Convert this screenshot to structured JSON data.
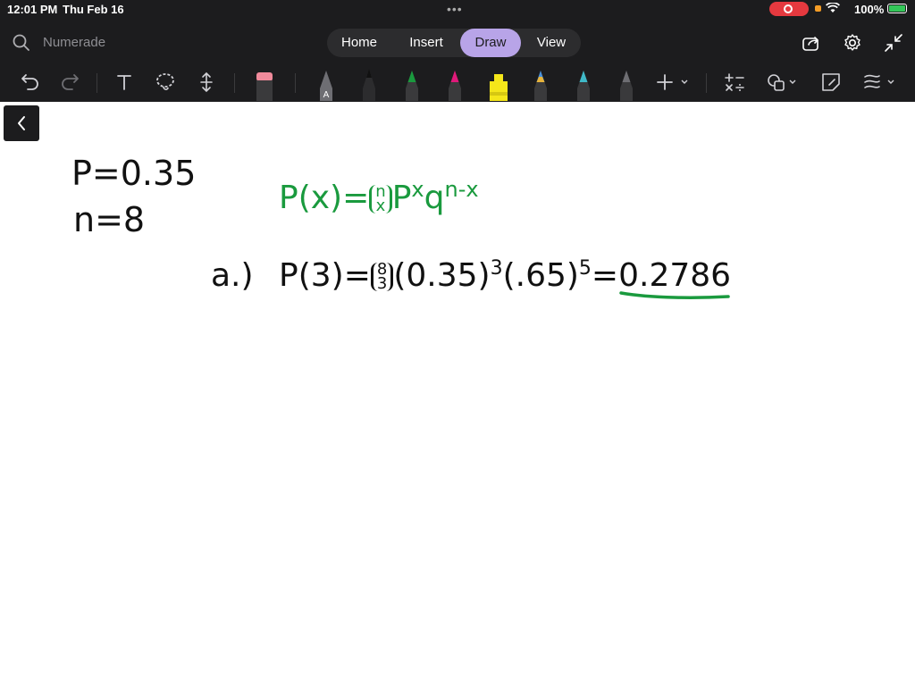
{
  "status_bar": {
    "time": "12:01 PM",
    "date": "Thu Feb 16",
    "battery": "100%"
  },
  "search": {
    "placeholder": "Numerade"
  },
  "tabs": [
    {
      "label": "Home"
    },
    {
      "label": "Insert"
    },
    {
      "label": "Draw",
      "active": true
    },
    {
      "label": "View"
    }
  ],
  "toolbar": {
    "pens": [
      {
        "name": "pen-a",
        "color": "#888888"
      },
      {
        "name": "pen-black",
        "color": "#111111"
      },
      {
        "name": "pen-green",
        "color": "#1a9a3e"
      },
      {
        "name": "pen-magenta",
        "color": "#e0197a"
      },
      {
        "name": "highlighter-yellow",
        "color": "#f5e61a"
      },
      {
        "name": "pen-multicolor",
        "color": "#4a90d9"
      },
      {
        "name": "pen-teal",
        "color": "#3fb9c8"
      },
      {
        "name": "pen-gray",
        "color": "#555555"
      }
    ],
    "pen_a_letter": "A"
  },
  "notes": {
    "line1": "P=0.35",
    "line2": "n=8",
    "formula": {
      "lhs": "P(x)=",
      "binom_top": "n",
      "binom_bottom": "x",
      "p": "P",
      "p_exp": "x",
      "q": "q",
      "q_exp": "n-x"
    },
    "part_a": {
      "label": "a.)",
      "lhs": "P(3)=",
      "binom_top": "8",
      "binom_bottom": "3",
      "term1": "(0.35)",
      "term1_exp": "3",
      "term2": "(.65)",
      "term2_exp": "5",
      "equals": "=",
      "answer": "0.2786"
    }
  }
}
